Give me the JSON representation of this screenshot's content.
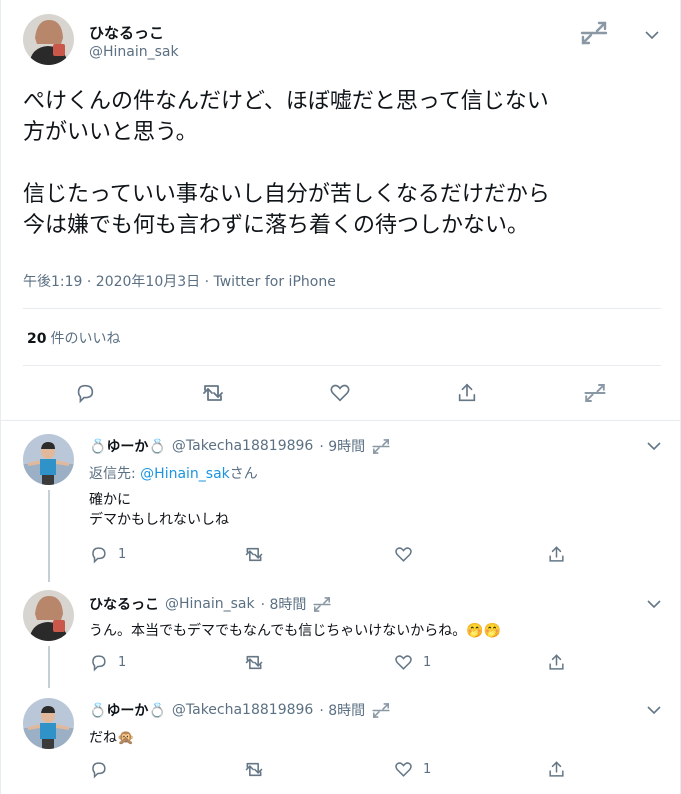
{
  "main_tweet": {
    "name": "ひなるっこ",
    "handle": "@Hinain_sak",
    "text_lines": [
      "ぺけくんの件なんだけど、ほぼ嘘だと思って信じない",
      "方がいいと思う。",
      "",
      "信じたっていい事ないし自分が苦しくなるだけだから",
      "今は嫌でも何も言わずに落ち着くの待つしかない。"
    ],
    "meta": "午後1:19 · 2020年10月3日 · Twitter for iPhone",
    "likes_count": "20",
    "likes_label": "件のいいね"
  },
  "replies": [
    {
      "name": "ゆーか",
      "name_emoji_left": "💍",
      "name_emoji_right": "💍",
      "handle": "@Takecha18819896",
      "time": "· 9時間",
      "reply_to_prefix": "返信先: ",
      "reply_to_mention": "@Hinain_sak",
      "reply_to_suffix": "さん",
      "text_lines": [
        "確かに",
        "デマかもしれないしね"
      ],
      "reply_count": "1",
      "like_count": ""
    },
    {
      "name": "ひなるっこ",
      "handle": "@Hinain_sak",
      "time": "· 8時間",
      "text_lines": [
        "うん。本当でもデマでもなんでも信じちゃいけないからね。"
      ],
      "text_emoji": "🤭🤭",
      "reply_count": "1",
      "like_count": "1"
    },
    {
      "name": "ゆーか",
      "name_emoji_left": "💍",
      "name_emoji_right": "💍",
      "handle": "@Takecha18819896",
      "time": "· 8時間",
      "text_lines": [
        "だね"
      ],
      "text_emoji": "🙊",
      "reply_count": "",
      "like_count": "1"
    }
  ],
  "colors": {
    "text": "#0f1419",
    "secondary": "#5b7083",
    "link": "#1b95e0",
    "border": "#e6ecf0",
    "icon": "#657786"
  },
  "icons": [
    "retweet-icon",
    "chevron-down-icon",
    "reply-icon",
    "heart-icon",
    "share-icon"
  ]
}
